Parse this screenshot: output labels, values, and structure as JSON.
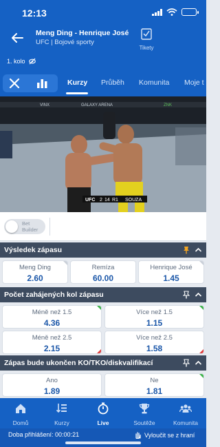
{
  "status_bar": {
    "time": "12:13"
  },
  "match": {
    "title": "Meng Ding - Henrique José",
    "subtitle": "UFC | Bojové sporty",
    "round": "1. kolo",
    "tickets_label": "Tikety"
  },
  "tabs": [
    {
      "label": "Kurzy",
      "active": true
    },
    {
      "label": "Průběh",
      "active": false
    },
    {
      "label": "Komunita",
      "active": false
    },
    {
      "label": "Moje t",
      "active": false
    }
  ],
  "video": {
    "scoreboard": {
      "left": "UFC",
      "round": "2",
      "clock": "14",
      "right": "R1",
      "fighter": "SOUZA"
    }
  },
  "bet_builder": {
    "label_line1": "Bet",
    "label_line2": "Builder",
    "enabled": false
  },
  "sections": {
    "result": {
      "title": "Výsledek zápasu",
      "options": [
        {
          "label": "Meng Ding",
          "odds": "2.60"
        },
        {
          "label": "Remíza",
          "odds": "60.00"
        },
        {
          "label": "Henrique José",
          "odds": "1.45"
        }
      ]
    },
    "rounds": {
      "title": "Počet zahájených kol zápasu",
      "rows": [
        [
          {
            "label": "Méně než 1.5",
            "odds": "4.36"
          },
          {
            "label": "Více než 1.5",
            "odds": "1.15"
          }
        ],
        [
          {
            "label": "Méně než 2.5",
            "odds": "2.15"
          },
          {
            "label": "Více než 2.5",
            "odds": "1.58"
          }
        ]
      ]
    },
    "ko": {
      "title": "Zápas bude ukončen KO/TKO/diskvalifikací",
      "options": [
        {
          "label": "Ano",
          "odds": "1.89"
        },
        {
          "label": "Ne",
          "odds": "1.81"
        }
      ]
    }
  },
  "bottom_nav": [
    {
      "label": "Domů",
      "icon": "home-icon",
      "active": false
    },
    {
      "label": "Kurzy",
      "icon": "list-icon",
      "active": false
    },
    {
      "label": "Live",
      "icon": "stopwatch-icon",
      "active": true
    },
    {
      "label": "Soutěže",
      "icon": "trophy-icon",
      "active": false
    },
    {
      "label": "Komunita",
      "icon": "community-icon",
      "active": false
    }
  ],
  "footer": {
    "login_label": "Doba přihlášení: 00:00:21",
    "exclude_label": "Vyloučit se z hraní"
  },
  "colors": {
    "brand": "#1561c4",
    "section_header": "#3d4b5f",
    "odds_text": "#1a56a8",
    "up_indicator": "#3cb44a",
    "down_indicator": "#e03b3b",
    "pin_orange": "#f5a623"
  }
}
